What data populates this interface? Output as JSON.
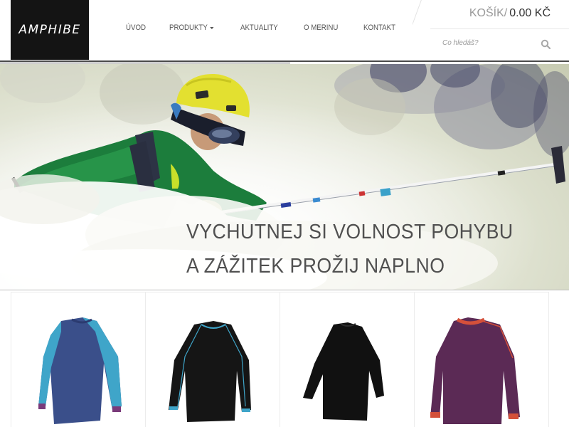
{
  "brand": {
    "logo_text": "AMPHIBE"
  },
  "nav": {
    "items": [
      {
        "label": "Úvod",
        "has_dropdown": false
      },
      {
        "label": "Produkty",
        "has_dropdown": true
      },
      {
        "label": "Aktuality",
        "has_dropdown": false
      },
      {
        "label": "O merinu",
        "has_dropdown": false
      },
      {
        "label": "Kontakt",
        "has_dropdown": false
      }
    ]
  },
  "cart": {
    "label": "Košík",
    "separator": "/",
    "price": "0.00 Kč"
  },
  "search": {
    "placeholder": "Co hledáš?",
    "icon": "magnifier"
  },
  "hero": {
    "line1": "Vychutnej si volnost pohybu",
    "line2": "a zážitek prožij naplno"
  },
  "products": [
    {
      "name": "product-shirt-blue",
      "body_color": "#3a4f8a",
      "sleeve_color": "#3fa5c9",
      "cuff_color": "#7a3a7a"
    },
    {
      "name": "product-shirt-black-blue",
      "body_color": "#151515",
      "sleeve_color": "#111111",
      "cuff_color": "#3fa5c9"
    },
    {
      "name": "product-shirt-black",
      "body_color": "#111111",
      "sleeve_color": "#111111",
      "cuff_color": "#111111"
    },
    {
      "name": "product-shirt-purple",
      "body_color": "#5b2a55",
      "sleeve_color": "#5b2a55",
      "cuff_color": "#d4503a"
    }
  ],
  "colors": {
    "accent": "#141414",
    "text": "#555555",
    "header_line": "#4a4a4a"
  }
}
